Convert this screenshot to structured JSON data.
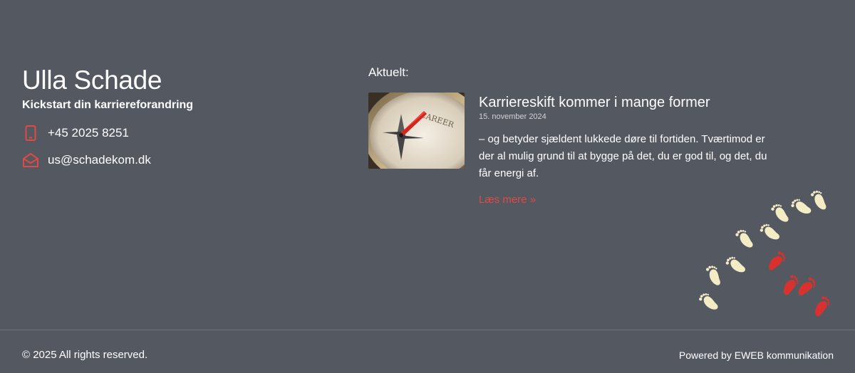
{
  "brand": {
    "name": "Ulla Schade",
    "tagline": "Kickstart din karriereforandring"
  },
  "contact": {
    "phone": "+45 2025 8251",
    "email": "us@schadekom.dk",
    "phone_icon": "phone-icon",
    "email_icon": "envelope-icon"
  },
  "news": {
    "heading": "Aktuelt:",
    "article": {
      "image_label": "CAREER",
      "title": "Karriereskift kommer i mange former",
      "date": "15. november 2024",
      "excerpt": "– og betyder sjældent lukkede døre til fortiden. Tværtimod er der al mulig grund til at bygge på det, du er god til, og det, du får energi af.",
      "read_more": "Læs mere »"
    }
  },
  "footer": {
    "copyright": "© 2025 All rights reserved.",
    "powered_by": "Powered by EWEB kommunikation"
  },
  "colors": {
    "background": "#545861",
    "accent": "#e04a44",
    "footprint_light": "#f3ecc4",
    "footprint_red": "#d9322e"
  }
}
